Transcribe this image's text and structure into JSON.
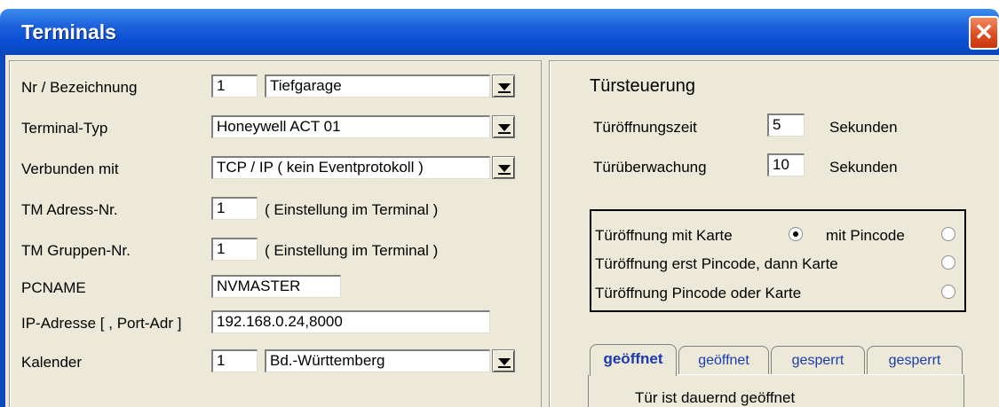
{
  "window": {
    "title": "Terminals",
    "close_glyph": "✕"
  },
  "left": {
    "nr_label": "Nr / Bezeichnung",
    "nr_value": "1",
    "bezeichnung_value": "Tiefgarage",
    "typ_label": "Terminal-Typ",
    "typ_value": "Honeywell ACT 01",
    "verbunden_label": "Verbunden mit",
    "verbunden_value": "TCP / IP  ( kein Eventprotokoll )",
    "tm_adress_label": "TM Adress-Nr.",
    "tm_adress_value": "1",
    "tm_adress_hint": "( Einstellung im Terminal )",
    "tm_gruppen_label": "TM Gruppen-Nr.",
    "tm_gruppen_value": "1",
    "tm_gruppen_hint": "( Einstellung im Terminal )",
    "pcname_label": "PCNAME",
    "pcname_value": "NVMASTER",
    "ip_label": "IP-Adresse [ , Port-Adr ]",
    "ip_value": "192.168.0.24,8000",
    "kalender_label": "Kalender",
    "kalender_nr": "1",
    "kalender_value": "Bd.-Württemberg"
  },
  "right": {
    "heading": "Türsteuerung",
    "oeffnungszeit_label": "Türöffnungszeit",
    "oeffnungszeit_value": "5",
    "oeffnungszeit_unit": "Sekunden",
    "ueberwachung_label": "Türüberwachung",
    "ueberwachung_value": "10",
    "ueberwachung_unit": "Sekunden",
    "options": {
      "karte_label": "Türöffnung mit Karte",
      "karte_selected": true,
      "pincode_label": "mit Pincode",
      "pincode_selected": false,
      "pin_dann_karte_label": "Türöffnung erst Pincode,  dann Karte",
      "pin_dann_karte_selected": false,
      "pin_oder_karte_label": "Türöffnung  Pincode oder Karte",
      "pin_oder_karte_selected": false
    },
    "tabs": [
      {
        "label": "geöffnet",
        "active": true
      },
      {
        "label": "geöffnet",
        "active": false
      },
      {
        "label": "gesperrt",
        "active": false
      },
      {
        "label": "gesperrt",
        "active": false
      }
    ],
    "tab_content_text": "Tür ist dauernd geöffnet"
  }
}
